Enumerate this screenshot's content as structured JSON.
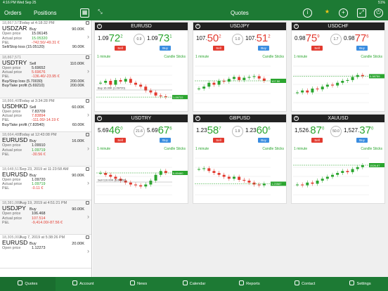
{
  "status_bar": {
    "time": "4:16 PM",
    "date": "Wed Sep 25",
    "right": "51%"
  },
  "header": {
    "orders_label": "Orders",
    "positions_label": "Positions",
    "quotes_title": "Quotes",
    "info_icon": "info-icon",
    "star_icon": "star-icon",
    "add_icon": "add-icon",
    "fullscreen_icon": "fullscreen-icon",
    "power_icon": "power-icon"
  },
  "positions": [
    {
      "id": "18,867,571",
      "date": "Today at 4:18:32 PM",
      "symbol": "USDZAR",
      "side": "Buy",
      "volume": "90.00K",
      "open_label": "Open price",
      "open": "15.06145",
      "actual_label": "Actual price",
      "actual": "15.05320",
      "actual_color": "green",
      "pl_label": "P&L",
      "pl": "-742.50/-49.31 €",
      "pl_color": "red",
      "extra": [
        {
          "label": "Sell/Stop loss (15.05120)",
          "value": "90.00K"
        }
      ]
    },
    {
      "id": "18,867,571",
      "date": "",
      "symbol": "USDTRY",
      "side": "Sell",
      "volume": "110.00K",
      "open_label": "Open price",
      "open": "5.69652",
      "actual_label": "Actual price",
      "actual": "5.69676",
      "actual_color": "red",
      "pl_label": "P&L",
      "pl": "-136.40/-23.95 €",
      "pl_color": "red",
      "extra": [
        {
          "label": "Buy/Stop loss (5.70030)",
          "value": "200.00K"
        },
        {
          "label": "Buy/Take profit (5.69210)",
          "value": "200.00K"
        }
      ]
    },
    {
      "id": "18,866,405",
      "date": "Today at 3:34:28 PM",
      "symbol": "USDHKD",
      "side": "Sell",
      "volume": "60.00K",
      "open_label": "Open price",
      "open": "7.83709",
      "actual_label": "Actual price",
      "actual": "7.83894",
      "actual_color": "red",
      "pl_label": "P&L",
      "pl": "-111.00/-14.19 €",
      "pl_color": "red",
      "extra": [
        {
          "label": "Buy/Take profit (7.83540)",
          "value": "60.00K"
        }
      ]
    },
    {
      "id": "18,664,488",
      "date": "Today at 12:43:08 PM",
      "symbol": "EURUSD",
      "side": "Buy",
      "volume": "16.00K",
      "open_label": "Open price",
      "open": "1.09910",
      "actual_label": "Actual price",
      "actual": "1.09719",
      "actual_color": "green",
      "pl_label": "P&L",
      "pl": "-30.56 €",
      "pl_color": "red",
      "extra": []
    },
    {
      "id": "18,648,517",
      "date": "Sep 23, 2019 at 11:23:58 AM",
      "symbol": "EURUSD",
      "side": "Buy",
      "volume": "90.00K",
      "open_label": "Open price",
      "open": "1.09720",
      "actual_label": "Actual price",
      "actual": "1.09719",
      "actual_color": "green",
      "pl_label": "P&L",
      "pl": "-0.11 €",
      "pl_color": "red",
      "extra": []
    },
    {
      "id": "18,381,089",
      "date": "Aug 19, 2019 at 4:51:21 PM",
      "symbol": "USDJPY",
      "side": "Buy",
      "volume": "90.00K",
      "open_label": "Open price",
      "open": "106.468",
      "actual_label": "Actual price",
      "actual": "107.514",
      "actual_color": "red",
      "pl_label": "P&L",
      "pl": "-9,414.00/-87.56 €",
      "pl_color": "red",
      "extra": []
    },
    {
      "id": "18,305,003",
      "date": "Aug 7, 2019 at 5:38:26 PM",
      "symbol": "EURUSD",
      "side": "Buy",
      "volume": "20.00K",
      "open_label": "Open price",
      "open": "1.12273",
      "actual_label": "",
      "actual": "",
      "actual_color": "green",
      "pl_label": "",
      "pl": "",
      "pl_color": "red",
      "extra": []
    }
  ],
  "quotes": [
    {
      "symbol": "EURUSD",
      "bid_pre": "1.09",
      "bid_big": "72",
      "bid_sup": "2",
      "bid_color": "green",
      "spread": "0.9",
      "ask_pre": "1.09",
      "ask_big": "73",
      "ask_sup": "1",
      "ask_color": "green",
      "sell": "Sell",
      "buy": "Buy",
      "interval": "1 minute",
      "chart_type": "Candle Sticks"
    },
    {
      "symbol": "USDJPY",
      "bid_pre": "107.",
      "bid_big": "50",
      "bid_sup": "2",
      "bid_color": "red",
      "spread": "1.0",
      "ask_pre": "107.",
      "ask_big": "51",
      "ask_sup": "2",
      "ask_color": "red",
      "sell": "Sell",
      "buy": "Buy",
      "interval": "1 minute",
      "chart_type": "Candle Sticks"
    },
    {
      "symbol": "USDCHF",
      "bid_pre": "0.98",
      "bid_big": "75",
      "bid_sup": "9",
      "bid_color": "red",
      "spread": "1.7",
      "ask_pre": "0.98",
      "ask_big": "77",
      "ask_sup": "6",
      "ask_color": "red",
      "sell": "Sell",
      "buy": "Buy",
      "interval": "1 minute",
      "chart_type": "Candle Sticks"
    },
    {
      "symbol": "USDTRY",
      "bid_pre": "5.69",
      "bid_big": "46",
      "bid_sup": "0",
      "bid_color": "green",
      "spread": "21.6",
      "ask_pre": "5.69",
      "ask_big": "67",
      "ask_sup": "6",
      "ask_color": "green",
      "sell": "Sell",
      "buy": "Buy",
      "interval": "1 minute",
      "chart_type": "Candle Sticks"
    },
    {
      "symbol": "GBPUSD",
      "bid_pre": "1.23",
      "bid_big": "58",
      "bid_sup": "7",
      "bid_color": "green",
      "spread": "1.9",
      "ask_pre": "1.23",
      "ask_big": "60",
      "ask_sup": "6",
      "ask_color": "green",
      "sell": "Sell",
      "buy": "Buy",
      "interval": "1 minute",
      "chart_type": "Candle Sticks"
    },
    {
      "symbol": "XAUUSD",
      "bid_pre": "1,526.",
      "bid_big": "87",
      "bid_sup": "0",
      "bid_color": "green",
      "spread": "50.0",
      "ask_pre": "1,527.",
      "ask_big": "37",
      "ask_sup": "0",
      "ask_color": "green",
      "sell": "Sell",
      "buy": "Buy",
      "interval": "1 minute",
      "chart_type": "Candle Sticks"
    }
  ],
  "chart_data": [
    {
      "type": "candlestick",
      "symbol": "EURUSD",
      "trend": [
        0.55,
        0.6,
        0.5,
        0.62,
        0.58,
        0.65,
        0.55,
        0.5,
        0.45,
        0.35,
        0.3,
        0.22,
        0.2,
        0.18
      ],
      "price_label": "1.09722",
      "line_label": "Buy 16.00K (1.09720)"
    },
    {
      "type": "candlestick",
      "symbol": "USDJPY",
      "trend": [
        0.4,
        0.45,
        0.55,
        0.5,
        0.6,
        0.58,
        0.65,
        0.7,
        0.62,
        0.68,
        0.7,
        0.72,
        0.66,
        0.6
      ],
      "price_label": "107.50",
      "line_label": ""
    },
    {
      "type": "candlestick",
      "symbol": "USDCHF",
      "trend": [
        0.3,
        0.35,
        0.3,
        0.4,
        0.38,
        0.45,
        0.5,
        0.48,
        0.55,
        0.6,
        0.62,
        0.7,
        0.75,
        0.72
      ],
      "price_label": "0.98759",
      "line_label": ""
    },
    {
      "type": "candlestick",
      "symbol": "USDTRY",
      "trend": [
        0.6,
        0.55,
        0.5,
        0.45,
        0.4,
        0.35,
        0.3,
        0.28,
        0.25,
        0.3,
        0.4,
        0.55,
        0.65,
        0.6
      ],
      "price_label": "5.69460",
      "line_label": "Sell 110.00K (5.69652)"
    },
    {
      "type": "candlestick",
      "symbol": "GBPUSD",
      "trend": [
        0.7,
        0.72,
        0.65,
        0.6,
        0.55,
        0.5,
        0.45,
        0.5,
        0.42,
        0.4,
        0.35,
        0.3,
        0.28,
        0.32
      ],
      "price_label": "1.23587",
      "line_label": ""
    },
    {
      "type": "candlestick",
      "symbol": "XAUUSD",
      "trend": [
        0.3,
        0.28,
        0.35,
        0.32,
        0.4,
        0.45,
        0.5,
        0.55,
        0.6,
        0.65,
        0.62,
        0.7,
        0.75,
        0.8
      ],
      "price_label": "1526.87",
      "line_label": ""
    }
  ],
  "bottom_nav": [
    {
      "label": "Quotes",
      "active": true
    },
    {
      "label": "Account",
      "active": false
    },
    {
      "label": "News",
      "active": false
    },
    {
      "label": "Calendar",
      "active": false
    },
    {
      "label": "Reports",
      "active": false
    },
    {
      "label": "Contact",
      "active": false
    },
    {
      "label": "Settings",
      "active": false
    }
  ]
}
